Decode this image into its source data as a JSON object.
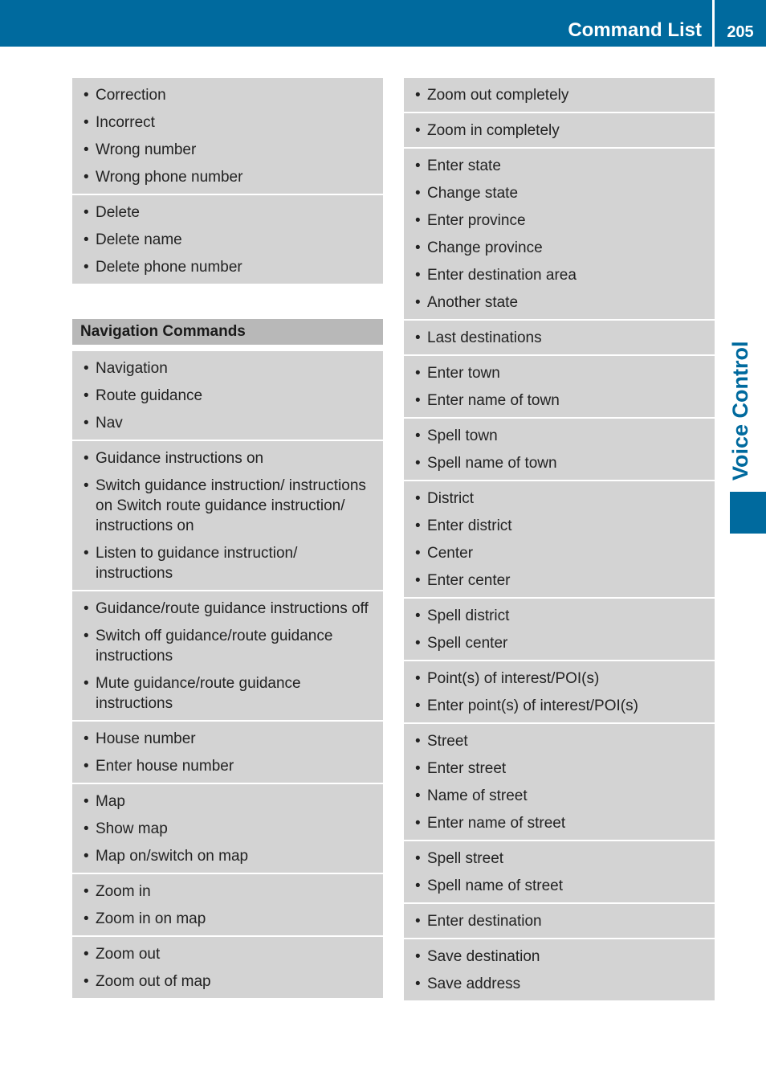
{
  "header": {
    "title": "Command List",
    "page_number": "205"
  },
  "side_tab": {
    "label": "Voice Control"
  },
  "colors": {
    "brand_blue": "#006a9e",
    "group_bg": "#d3d3d3",
    "section_header_bg": "#b8b8b8"
  },
  "left_column": {
    "top_groups": [
      {
        "items": [
          "Correction",
          "Incorrect",
          "Wrong number",
          "Wrong phone number"
        ]
      },
      {
        "items": [
          "Delete",
          "Delete name",
          "Delete phone number"
        ]
      }
    ],
    "section_title": "Navigation Commands",
    "groups": [
      {
        "items": [
          "Navigation",
          "Route guidance",
          "Nav"
        ]
      },
      {
        "items": [
          "Guidance instructions on",
          "Switch guidance instruction/ instructions on Switch route guidance instruction/ instructions on",
          "Listen to guidance instruction/ instructions"
        ]
      },
      {
        "items": [
          "Guidance/route guidance instructions off",
          "Switch off guidance/route guidance instructions",
          "Mute guidance/route guidance instructions"
        ]
      },
      {
        "items": [
          "House number",
          "Enter house number"
        ]
      },
      {
        "items": [
          "Map",
          "Show map",
          "Map on/switch on map"
        ]
      },
      {
        "items": [
          "Zoom in",
          "Zoom in on map"
        ]
      },
      {
        "items": [
          "Zoom out",
          "Zoom out of map"
        ]
      }
    ]
  },
  "right_column": {
    "groups": [
      {
        "items": [
          "Zoom out completely"
        ]
      },
      {
        "items": [
          "Zoom in completely"
        ]
      },
      {
        "items": [
          "Enter state",
          "Change state",
          "Enter province",
          "Change province",
          "Enter destination area",
          "Another state"
        ]
      },
      {
        "items": [
          "Last destinations"
        ]
      },
      {
        "items": [
          "Enter town",
          "Enter name of town"
        ]
      },
      {
        "items": [
          "Spell town",
          "Spell name of town"
        ]
      },
      {
        "items": [
          "District",
          "Enter district",
          "Center",
          "Enter center"
        ]
      },
      {
        "items": [
          "Spell district",
          "Spell center"
        ]
      },
      {
        "items": [
          "Point(s) of interest/POI(s)",
          "Enter point(s) of interest/POI(s)"
        ]
      },
      {
        "items": [
          "Street",
          "Enter street",
          "Name of street",
          "Enter name of street"
        ]
      },
      {
        "items": [
          "Spell street",
          "Spell name of street"
        ]
      },
      {
        "items": [
          "Enter destination"
        ]
      },
      {
        "items": [
          "Save destination",
          "Save address"
        ]
      }
    ]
  }
}
